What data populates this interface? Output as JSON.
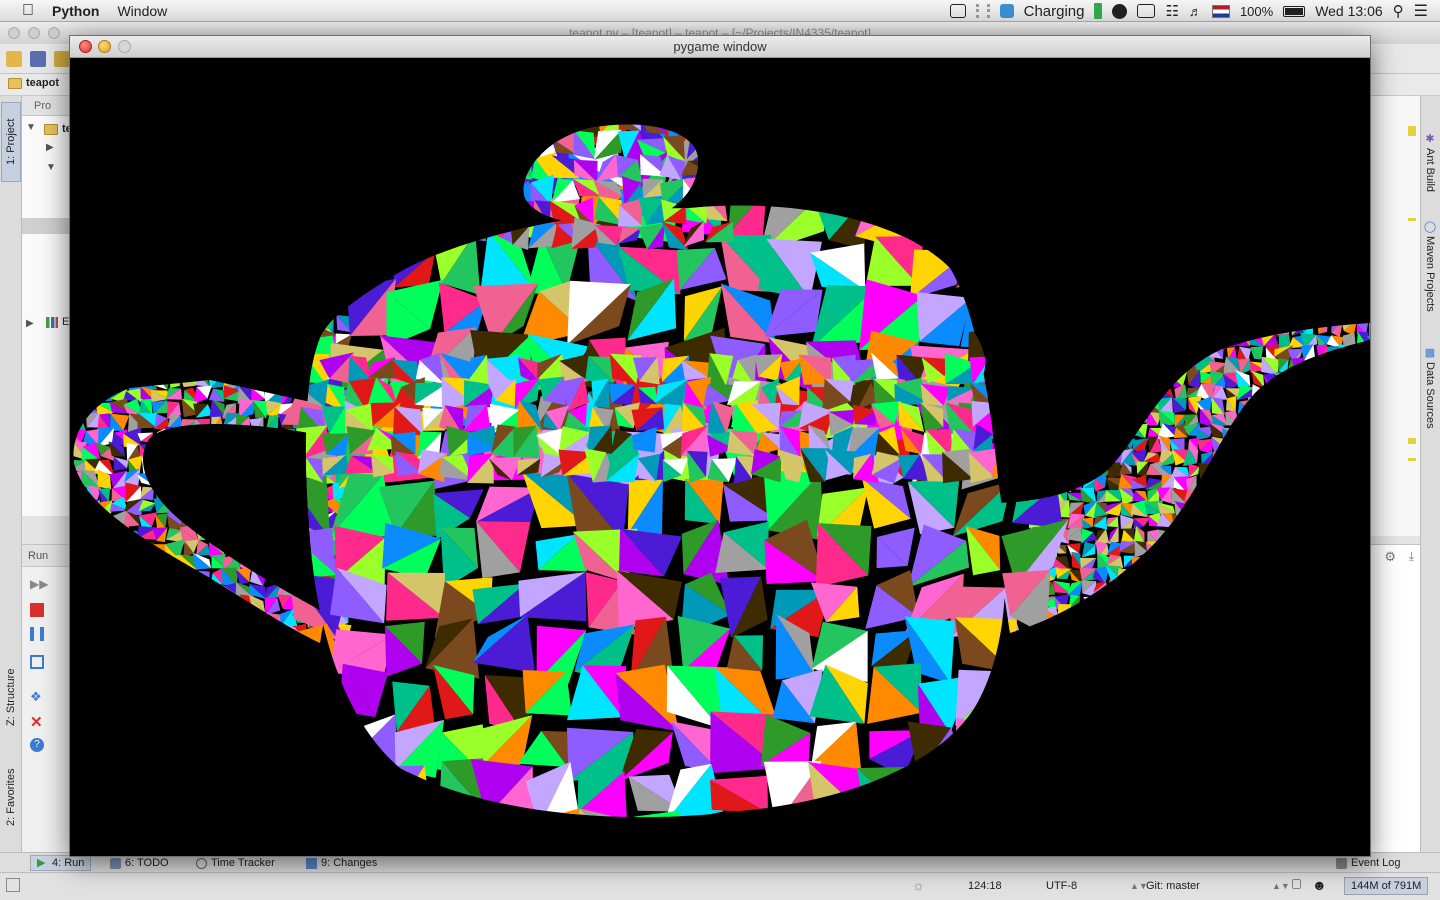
{
  "menubar": {
    "apple_icon": "apple-logo",
    "app_name": "Python",
    "menus": [
      "Window"
    ],
    "battery_status": "Charging",
    "battery_percent": "100%",
    "clock": "Wed 13:06",
    "language_flag": "netherlands-flag"
  },
  "ide": {
    "window_title": "teapot.py – [teapot] – teapot – [~/Projects/IN4335/teapot]",
    "breadcrumb_project": "teapot",
    "project_pane_title": "Pro",
    "tree_items": [
      "te",
      "E"
    ],
    "run_pane_title": "Run",
    "side_tabs_left": [
      "1: Project",
      "Z: Structure",
      "2: Favorites"
    ],
    "side_tabs_right": [
      "Ant Build",
      "Maven Projects",
      "Data Sources"
    ],
    "bottom_tabs": [
      {
        "label": "4: Run",
        "active": true
      },
      {
        "label": "6: TODO",
        "active": false
      },
      {
        "label": "Time Tracker",
        "active": false
      },
      {
        "label": "9: Changes",
        "active": false
      }
    ],
    "event_log": "Event Log",
    "status": {
      "position": "124:18",
      "encoding": "UTF-8",
      "git": "Git: master",
      "memory": "144M of 791M"
    }
  },
  "pygame": {
    "title": "pygame window",
    "scene": "utah-teapot-random-colored-triangles",
    "background": "#000000",
    "palette": [
      "#ff2a8c",
      "#ff00ff",
      "#b000f0",
      "#4b1bd6",
      "#00e5ff",
      "#00ff5a",
      "#9bff2a",
      "#ffd400",
      "#ff8a00",
      "#e11818",
      "#00c08a",
      "#2d9a2a",
      "#8e5cff",
      "#ff66d0",
      "#d4c46a",
      "#7a4a1e",
      "#009ab8",
      "#c3a6ff",
      "#ffffff",
      "#0a8cff",
      "#22c55e",
      "#f06292",
      "#3e2b00",
      "#a0a0a0"
    ]
  }
}
